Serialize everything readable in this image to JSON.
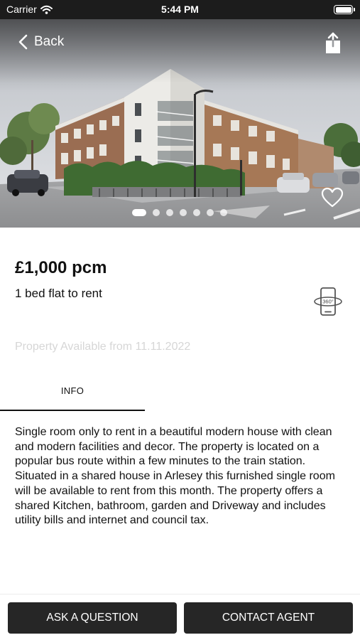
{
  "status_bar": {
    "carrier": "Carrier",
    "time": "5:44 PM"
  },
  "header": {
    "back_label": "Back",
    "icons": [
      "back-chevron-icon",
      "share-icon",
      "heart-icon"
    ]
  },
  "carousel": {
    "image_count": 7,
    "active_index": 0
  },
  "listing": {
    "price": "£1,000 pcm",
    "subtitle": "1 bed flat to rent",
    "tour_icon_label": "360°",
    "availability": "Property Available from 11.11.2022"
  },
  "tabs": [
    {
      "label": "INFO",
      "active": true
    }
  ],
  "description": "Single room only to rent in a beautiful modern house with clean and modern facilities and decor. The property is located on a popular bus route within a few minutes to the train station. Situated in a shared house in Arlesey this furnished single room will be available to rent from this month. The property offers a shared Kitchen, bathroom, garden and Driveway and includes utility bills and internet and council tax.",
  "actions": {
    "ask_label": "ASK A QUESTION",
    "contact_label": "CONTACT AGENT"
  },
  "colors": {
    "status_bar": "#1c1c1c",
    "button": "#262626",
    "availability_text": "#d6d6d6"
  }
}
